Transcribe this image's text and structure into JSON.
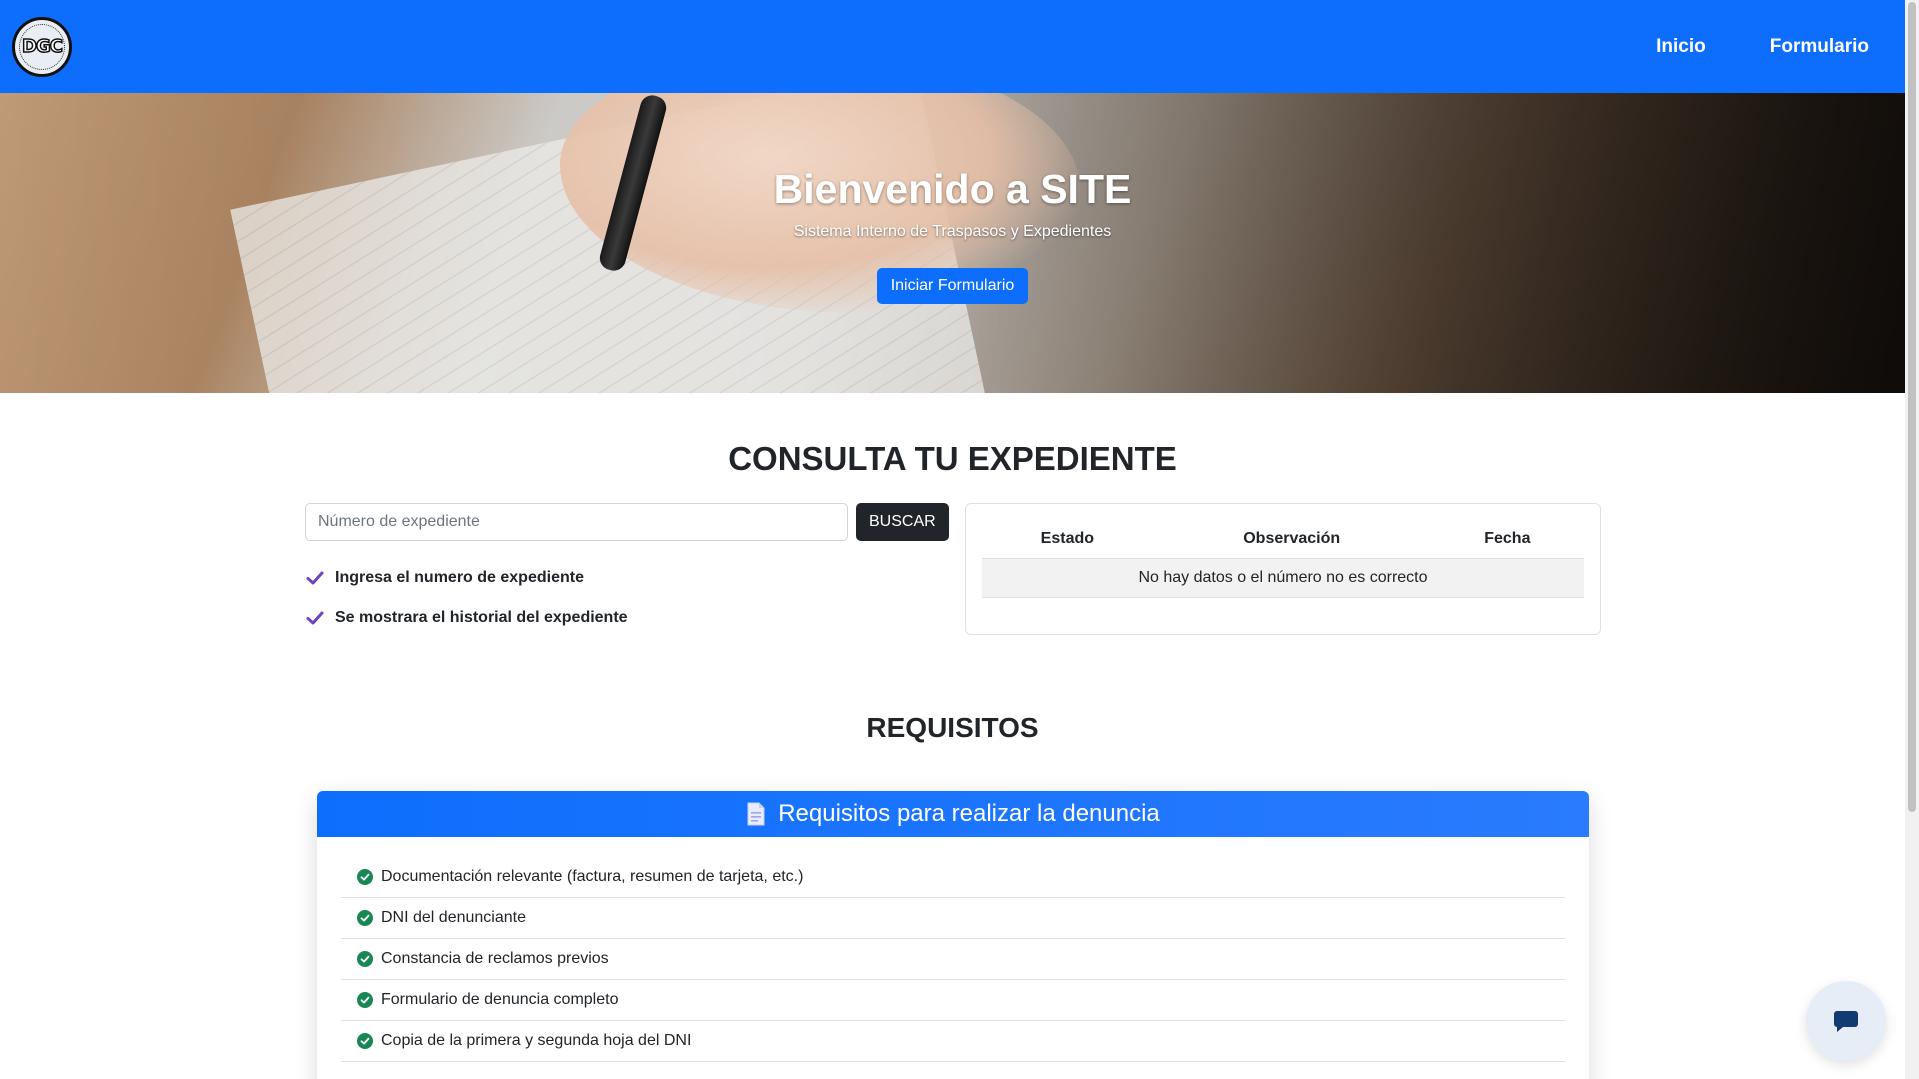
{
  "navbar": {
    "logo_text": "DGC",
    "links": [
      "Inicio",
      "Formulario"
    ],
    "bg_color": "#0d6efd"
  },
  "hero": {
    "title": "Bienvenido a SITE",
    "subtitle": "Sistema Interno de Traspasos y Expedientes",
    "button_label": "Iniciar Formulario"
  },
  "consulta": {
    "title": "CONSULTA TU EXPEDIENTE",
    "search_placeholder": "Número de expediente",
    "search_button": "BUSCAR",
    "checks": [
      "Ingresa el numero de expediente",
      "Se mostrara el historial del expediente"
    ],
    "table": {
      "headers": [
        "Estado",
        "Observación",
        "Fecha"
      ],
      "empty_message": "No hay datos o el número no es correcto"
    }
  },
  "requisitos": {
    "title": "REQUISITOS",
    "card_title": "Requisitos para realizar la denuncia",
    "card_icon": "document-icon",
    "items": [
      "Documentación relevante (factura, resumen de tarjeta, etc.)",
      "DNI del denunciante",
      "Constancia de reclamos previos",
      "Formulario de denuncia completo",
      "Copia de la primera y segunda hoja del DNI"
    ]
  },
  "chat": {
    "icon": "chat-icon"
  }
}
